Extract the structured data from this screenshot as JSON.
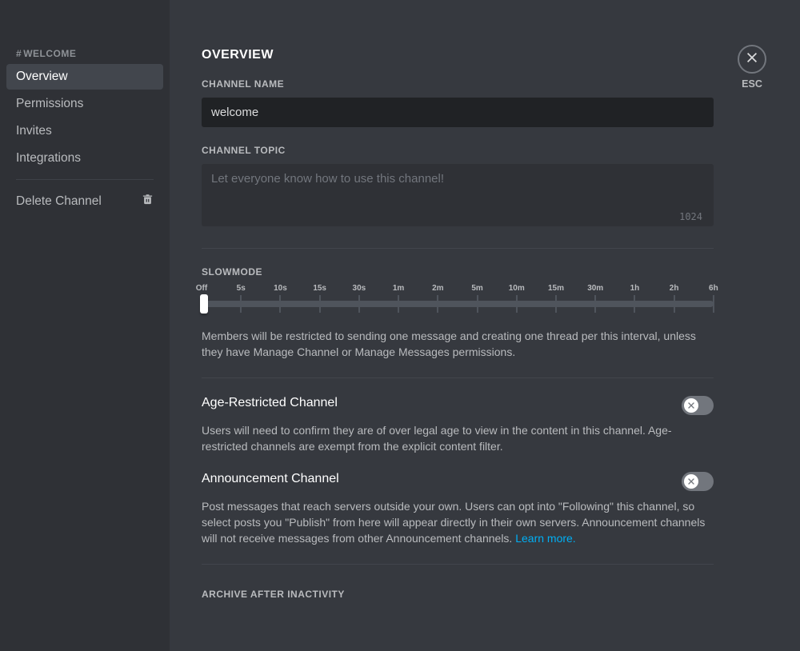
{
  "sidebar": {
    "header_prefix": "#",
    "header": "WELCOME",
    "items": [
      {
        "label": "Overview",
        "active": true
      },
      {
        "label": "Permissions",
        "active": false
      },
      {
        "label": "Invites",
        "active": false
      },
      {
        "label": "Integrations",
        "active": false
      }
    ],
    "delete_label": "Delete Channel"
  },
  "close": {
    "esc_label": "ESC"
  },
  "overview": {
    "title": "OVERVIEW",
    "channel_name_label": "CHANNEL NAME",
    "channel_name_value": "welcome",
    "channel_topic_label": "CHANNEL TOPIC",
    "channel_topic_placeholder": "Let everyone know how to use this channel!",
    "channel_topic_charcount": "1024",
    "slowmode": {
      "label": "SLOWMODE",
      "ticks": [
        "Off",
        "5s",
        "10s",
        "15s",
        "30s",
        "1m",
        "2m",
        "5m",
        "10m",
        "15m",
        "30m",
        "1h",
        "2h",
        "6h"
      ],
      "help": "Members will be restricted to sending one message and creating one thread per this interval, unless they have Manage Channel or Manage Messages permissions."
    },
    "age_restricted": {
      "title": "Age-Restricted Channel",
      "help": "Users will need to confirm they are of over legal age to view in the content in this channel. Age-restricted channels are exempt from the explicit content filter."
    },
    "announcement": {
      "title": "Announcement Channel",
      "help": "Post messages that reach servers outside your own. Users can opt into \"Following\" this channel, so select posts you \"Publish\" from here will appear directly in their own servers. Announcement channels will not receive messages from other Announcement channels. ",
      "learn_more": "Learn more."
    },
    "archive_label": "ARCHIVE AFTER INACTIVITY"
  }
}
